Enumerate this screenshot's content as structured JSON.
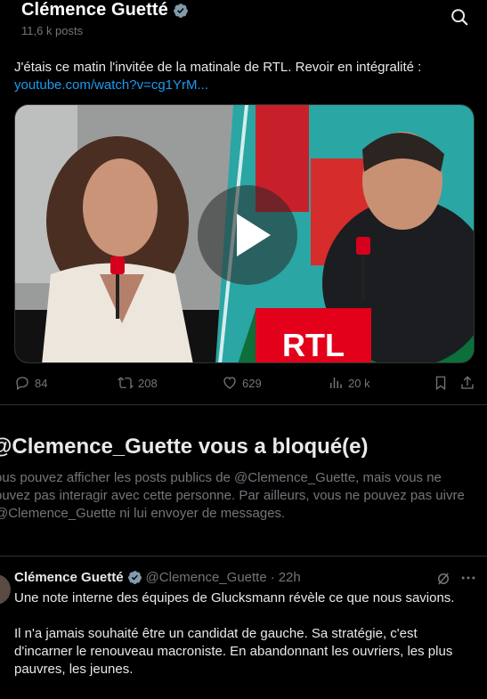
{
  "header": {
    "name": "Clémence Guetté",
    "post_count": "11,6 k posts"
  },
  "tweet": {
    "text": "J'étais ce matin l'invitée de la matinale de RTL. Revoir en intégralité :",
    "link": "youtube.com/watch?v=cg1YrM...",
    "media": {
      "brand": "RTL"
    },
    "stats": {
      "replies": "84",
      "reposts": "208",
      "likes": "629",
      "views": "20 k"
    }
  },
  "blocked": {
    "title": "@Clemence_Guette vous a bloqué(e)",
    "description": "ous pouvez afficher les posts publics de @Clemence_Guette, mais vous ne ouvez pas interagir avec cette personne. Par ailleurs, vous ne pouvez pas uivre @Clemence_Guette ni lui envoyer de messages."
  },
  "tweet2": {
    "name": "Clémence Guetté",
    "handle": "@Clemence_Guette",
    "separator": "·",
    "time": "22h",
    "paragraph1": "Une note interne des équipes de Glucksmann révèle ce que nous savions.",
    "paragraph2": "Il n'a jamais souhaité être un candidat de gauche. Sa stratégie, c'est d'incarner le renouveau macroniste. En abandonnant les ouvriers, les plus pauvres, les jeunes."
  },
  "colors": {
    "background": "#000000",
    "text": "#e7e9ea",
    "muted": "#71767b",
    "link": "#1d9bf0",
    "divider": "#2f3336",
    "rtl_red": "#e2001a"
  },
  "icons": [
    "verified-icon",
    "search-icon",
    "play-icon",
    "reply-icon",
    "repost-icon",
    "like-icon",
    "views-icon",
    "bookmark-icon",
    "share-icon",
    "grok-icon",
    "more-icon"
  ]
}
